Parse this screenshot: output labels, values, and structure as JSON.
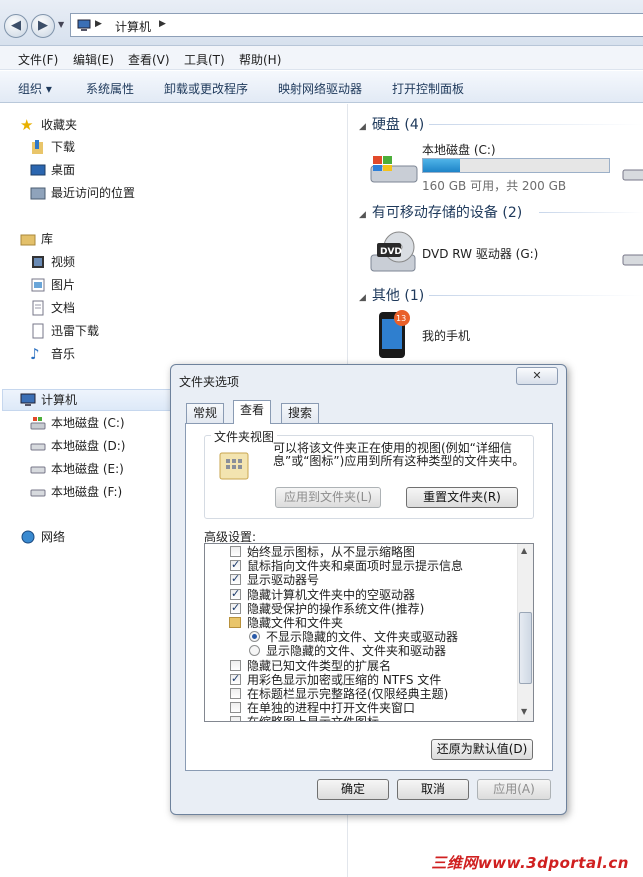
{
  "address": {
    "crumb": "计算机"
  },
  "menu": [
    "文件(F)",
    "编辑(E)",
    "查看(V)",
    "工具(T)",
    "帮助(H)"
  ],
  "toolbar": {
    "organize": "组织",
    "items": [
      "系统属性",
      "卸载或更改程序",
      "映射网络驱动器",
      "打开控制面板"
    ]
  },
  "nav": {
    "favorites": "收藏夹",
    "downloads": "下载",
    "desktop": "桌面",
    "recent": "最近访问的位置",
    "library": "库",
    "videos": "视频",
    "pictures": "图片",
    "documents": "文档",
    "xunlei": "迅雷下载",
    "music": "音乐",
    "computer": "计算机",
    "driveC": "本地磁盘 (C:)",
    "driveD": "本地磁盘 (D:)",
    "driveE": "本地磁盘 (E:)",
    "driveF": "本地磁盘 (F:)",
    "network": "网络"
  },
  "content": {
    "hdd_group": "硬盘 (4)",
    "driveC_name": "本地磁盘 (C:)",
    "driveC_space": "160 GB 可用，共 200 GB",
    "driveC_used_fraction": 0.2,
    "removable_group": "有可移动存储的设备 (2)",
    "dvd_name": "DVD RW 驱动器 (G:)",
    "dvd_label": "DVD",
    "other_group": "其他 (1)",
    "phone_name": "我的手机",
    "phone_badge": "13"
  },
  "dialog": {
    "title": "文件夹选项",
    "close": "✕",
    "tabs": [
      "常规",
      "查看",
      "搜索"
    ],
    "folder_views_label": "文件夹视图",
    "folder_views_desc": "可以将该文件夹正在使用的视图(例如“详细信息”或“图标”)应用到所有这种类型的文件夹中。",
    "apply_to_folders": "应用到文件夹(L)",
    "reset_folders": "重置文件夹(R)",
    "advanced_label": "高级设置:",
    "settings": [
      {
        "kind": "checkbox",
        "checked": false,
        "label": "始终显示图标，从不显示缩略图"
      },
      {
        "kind": "checkbox",
        "checked": true,
        "label": "鼠标指向文件夹和桌面项时显示提示信息"
      },
      {
        "kind": "checkbox",
        "checked": true,
        "label": "显示驱动器号"
      },
      {
        "kind": "checkbox",
        "checked": true,
        "label": "隐藏计算机文件夹中的空驱动器"
      },
      {
        "kind": "checkbox",
        "checked": true,
        "label": "隐藏受保护的操作系统文件(推荐)"
      },
      {
        "kind": "folder",
        "label": "隐藏文件和文件夹"
      },
      {
        "kind": "radio",
        "checked": true,
        "label": "不显示隐藏的文件、文件夹或驱动器"
      },
      {
        "kind": "radio",
        "checked": false,
        "label": "显示隐藏的文件、文件夹和驱动器"
      },
      {
        "kind": "checkbox",
        "checked": false,
        "label": "隐藏已知文件类型的扩展名"
      },
      {
        "kind": "checkbox",
        "checked": true,
        "label": "用彩色显示加密或压缩的 NTFS 文件"
      },
      {
        "kind": "checkbox",
        "checked": false,
        "label": "在标题栏显示完整路径(仅限经典主题)"
      },
      {
        "kind": "checkbox",
        "checked": false,
        "label": "在单独的进程中打开文件夹窗口"
      },
      {
        "kind": "checkbox",
        "checked": false,
        "label": "在缩略图上显示文件图标"
      }
    ],
    "restore_defaults": "还原为默认值(D)",
    "ok": "确定",
    "cancel": "取消",
    "apply": "应用(A)"
  },
  "watermark": "三维网www.3dportal.cn"
}
